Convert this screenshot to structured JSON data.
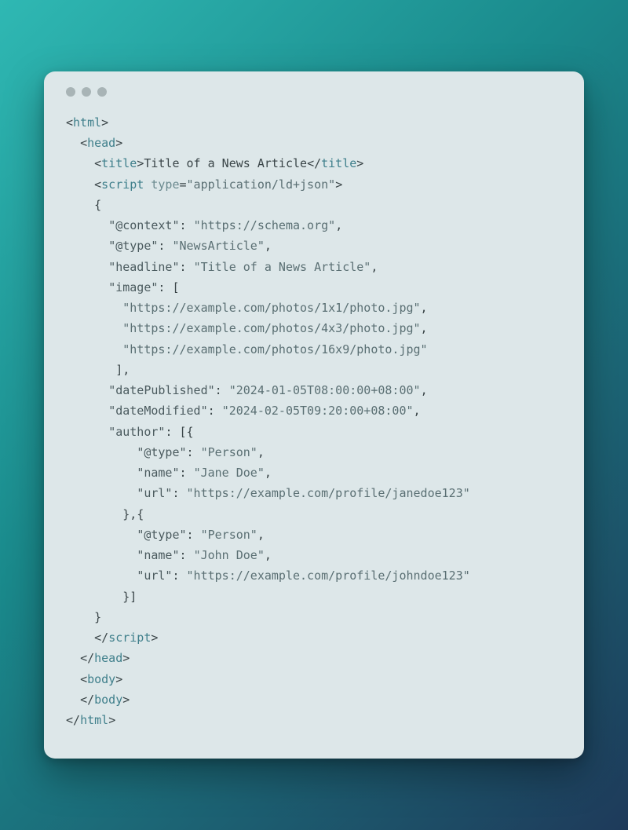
{
  "code": {
    "tags": {
      "html": "html",
      "head": "head",
      "title": "title",
      "script": "script",
      "body": "body"
    },
    "attr_type_name": "type",
    "attr_type_value": "\"application/ld+json\"",
    "title_text": "Title of a News Article",
    "json": {
      "context_key": "\"@context\"",
      "context_val": "\"https://schema.org\"",
      "type_key": "\"@type\"",
      "type_val": "\"NewsArticle\"",
      "headline_key": "\"headline\"",
      "headline_val": "\"Title of a News Article\"",
      "image_key": "\"image\"",
      "image_vals": [
        "\"https://example.com/photos/1x1/photo.jpg\"",
        "\"https://example.com/photos/4x3/photo.jpg\"",
        "\"https://example.com/photos/16x9/photo.jpg\""
      ],
      "datePublished_key": "\"datePublished\"",
      "datePublished_val": "\"2024-01-05T08:00:00+08:00\"",
      "dateModified_key": "\"dateModified\"",
      "dateModified_val": "\"2024-02-05T09:20:00+08:00\"",
      "author_key": "\"author\"",
      "author_type_key": "\"@type\"",
      "author_type_val": "\"Person\"",
      "author_name_key": "\"name\"",
      "author_url_key": "\"url\"",
      "authors": [
        {
          "name": "\"Jane Doe\"",
          "url": "\"https://example.com/profile/janedoe123\""
        },
        {
          "name": "\"John Doe\"",
          "url": "\"https://example.com/profile/johndoe123\""
        }
      ]
    }
  }
}
